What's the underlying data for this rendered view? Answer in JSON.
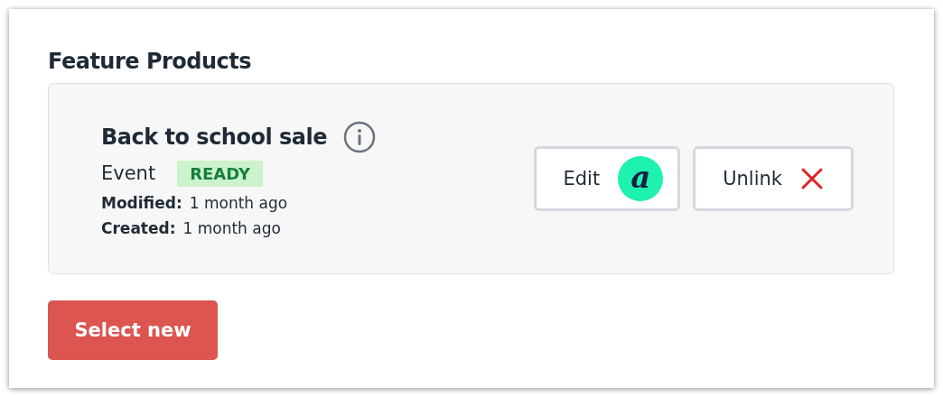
{
  "section_title": "Feature Products",
  "product": {
    "name": "Back to school sale",
    "type": "Event",
    "status": {
      "label": "READY",
      "color": "#cdf3cd"
    },
    "meta": [
      {
        "label": "Modified:",
        "value": "1 month ago"
      },
      {
        "label": "Created:",
        "value": "1 month ago"
      }
    ]
  },
  "actions": [
    {
      "kind": "edit",
      "label": "Edit",
      "logo": "a"
    },
    {
      "kind": "unlink",
      "label": "Unlink"
    }
  ],
  "primary_button": "Select new"
}
